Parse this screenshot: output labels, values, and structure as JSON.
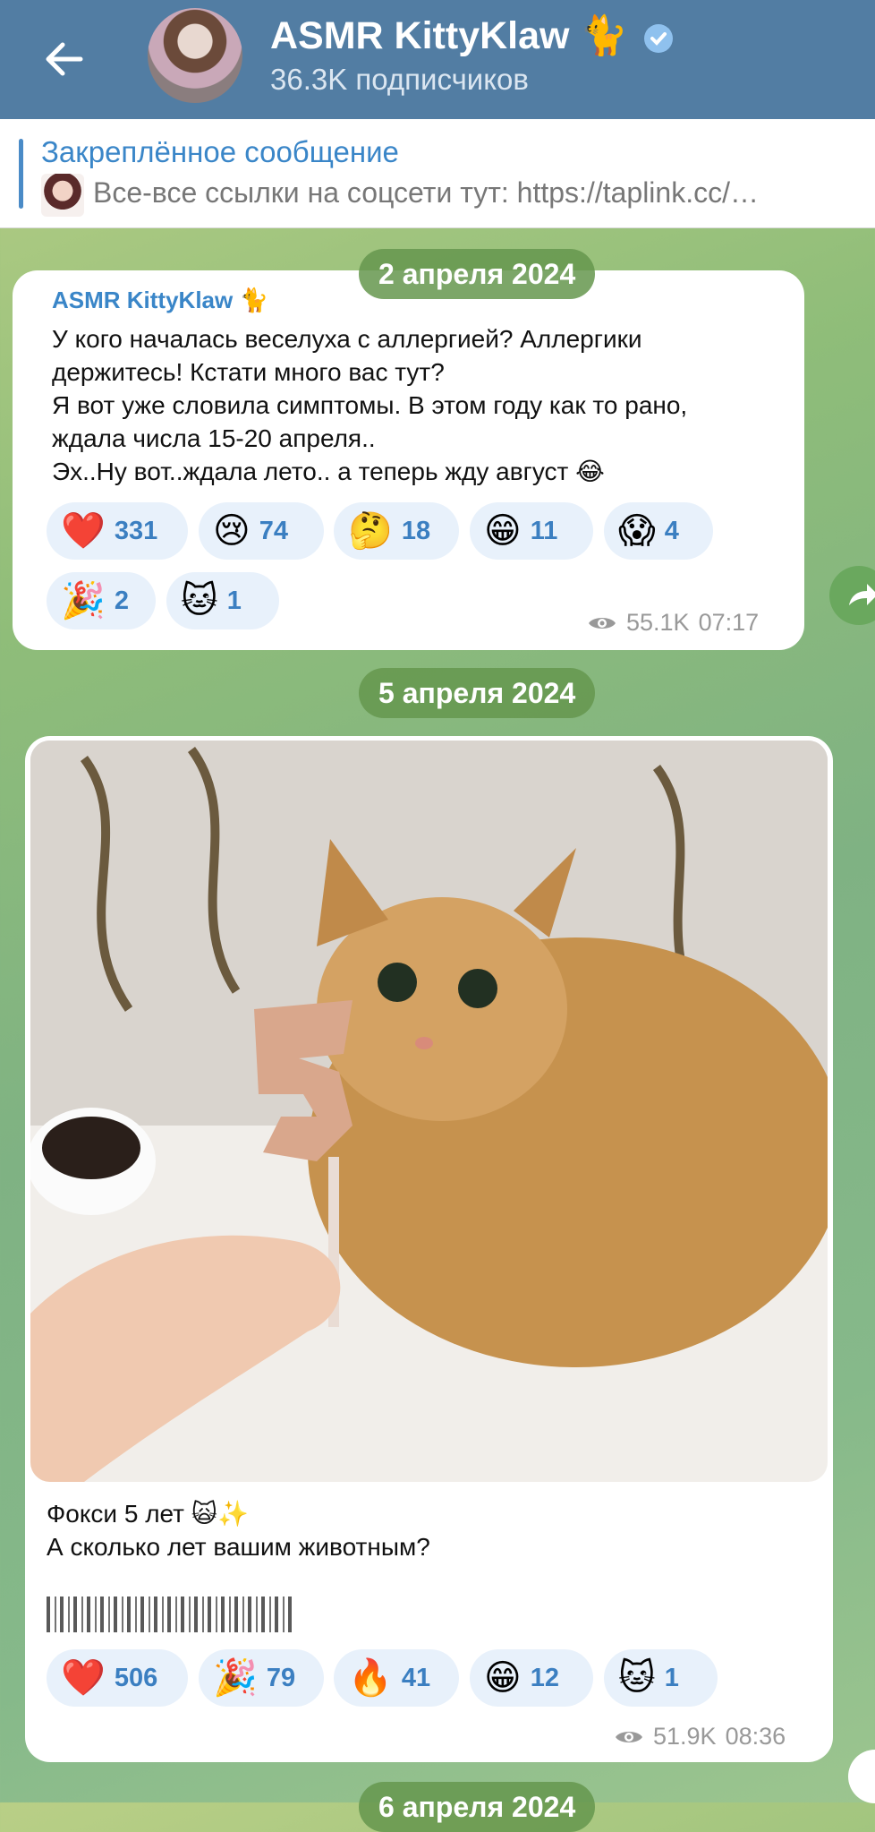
{
  "header": {
    "title": "ASMR KittyKlaw 🐈",
    "subscribers": "36.3K подписчиков",
    "colors": {
      "bar": "#527da3",
      "accent": "#3a86c8"
    }
  },
  "pinned": {
    "title": "Закреплённое сообщение",
    "text": "Все-все ссылки на соцсети тут: https://taplink.cc/…"
  },
  "posts": [
    {
      "date": "2 апреля 2024",
      "author": "ASMR KittyKlaw 🐈",
      "lines": [
        "У кого началась веселуха с аллергией? Аллергики",
        "держитесь! Кстати много вас тут?",
        "Я вот уже словила симптомы. В этом году как то рано,",
        "ждала числа 15-20  апреля..",
        "Эх..Ну вот..ждала лето.. а теперь жду август 😂"
      ],
      "reactions": [
        {
          "emoji": "❤️",
          "count": "331"
        },
        {
          "emoji": "😢",
          "count": "74"
        },
        {
          "emoji": "🤔",
          "count": "18"
        },
        {
          "emoji": "😁",
          "count": "11"
        },
        {
          "emoji": "😱",
          "count": "4"
        },
        {
          "emoji": "🎉",
          "count": "2"
        },
        {
          "emoji": "🐱",
          "count": "1"
        }
      ],
      "views": "55.1K",
      "time": "07:17"
    },
    {
      "date": "5 апреля 2024",
      "lines": [
        "Фокси 5 лет 🙀✨",
        "А сколько лет вашим животным?"
      ],
      "reactions": [
        {
          "emoji": "❤️",
          "count": "506"
        },
        {
          "emoji": "🎉",
          "count": "79"
        },
        {
          "emoji": "🔥",
          "count": "41"
        },
        {
          "emoji": "😁",
          "count": "12"
        },
        {
          "emoji": "🐱",
          "count": "1"
        }
      ],
      "views": "51.9K",
      "time": "08:36"
    }
  ],
  "next_date": "6 апреля 2024"
}
